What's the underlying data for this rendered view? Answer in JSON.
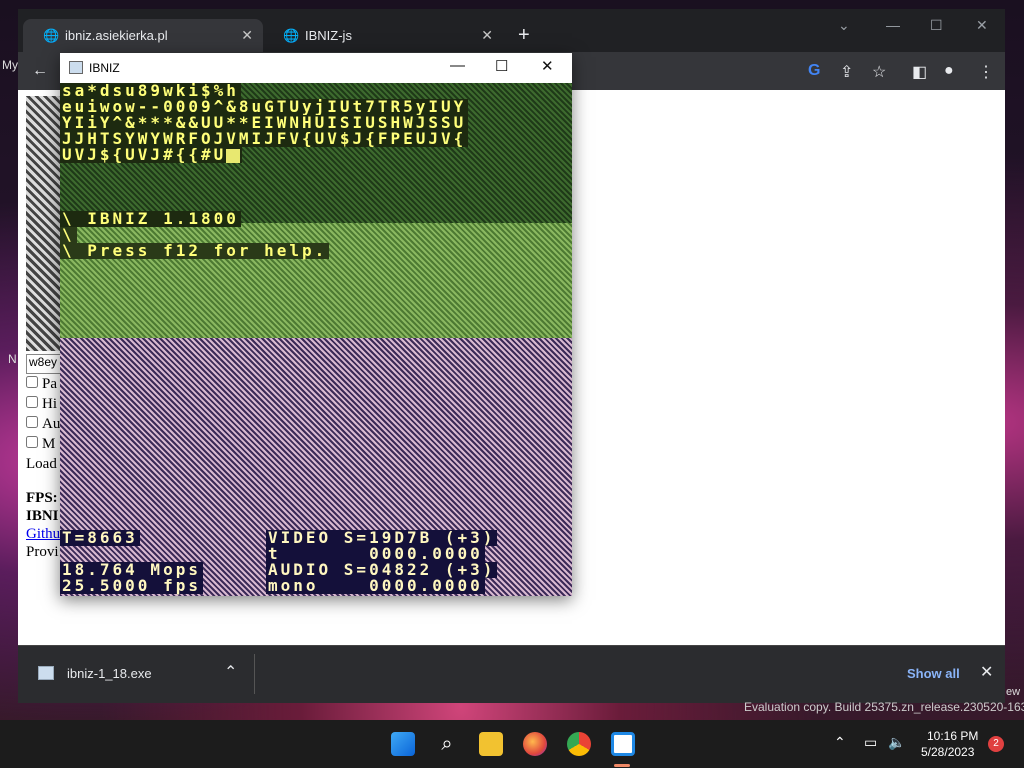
{
  "desktop": {
    "edge_text_1": "My",
    "edge_text_2": "N",
    "edge_text_3": "ew",
    "evaluation": "Evaluation copy. Build 25375.zn_release.230520-1632"
  },
  "browser": {
    "tabs": [
      {
        "title": "ibniz.asiekierka.pl",
        "active": true
      },
      {
        "title": "IBNIZ-js",
        "active": false
      }
    ],
    "page": {
      "input_value": "w8ey",
      "checkboxes": [
        "Pa",
        "Hi",
        "Au",
        "M"
      ],
      "status": "Load",
      "fps_label": "FPS:",
      "ibniz_label": "IBNI",
      "github_link": "Githu",
      "provided": "Provi"
    },
    "downloads": {
      "file": "ibniz-1_18.exe",
      "show_all": "Show all"
    }
  },
  "ibniz": {
    "title": "IBNIZ",
    "code_lines": [
      "sa*dsu89wki$%h",
      "euiwow--0009^&8uGTUyjIUt7TR5yIUY",
      "YIiY^&***&&UU**EIWNHUISIUSHWJSSU",
      "JJHTSYWYWRFOJVMIJFV{UV$J{FPEUJV{",
      "UVJ${UVJ#{{#U"
    ],
    "banner": "\\ IBNIZ 1.1800",
    "blank": "\\",
    "help": "\\ Press f12 for help.",
    "stats": {
      "t": "T=8663",
      "video": "VIDEO S=19D7B (+3)",
      "t_val": "t       0000.0000",
      "mops": "18.764 Mops",
      "audio": "AUDIO S=04822 (+3)",
      "fps": "25.5000 fps",
      "mono": "mono    0000.0000"
    }
  },
  "taskbar": {
    "time": "10:16 PM",
    "date": "5/28/2023",
    "notifications": "2"
  }
}
